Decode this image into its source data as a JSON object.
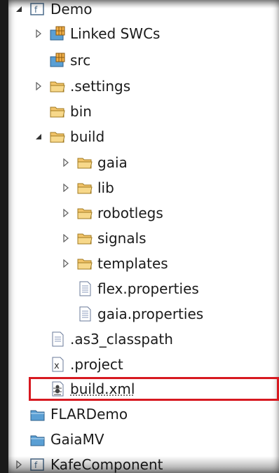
{
  "tree": {
    "items": [
      {
        "label": "Demo",
        "icon": "flex-project-icon",
        "arrow": "expanded",
        "depth": 0
      },
      {
        "label": "Linked SWCs",
        "icon": "library-icon",
        "arrow": "collapsed",
        "depth": 1
      },
      {
        "label": "src",
        "icon": "source-folder-icon",
        "arrow": "none",
        "depth": 1
      },
      {
        "label": ".settings",
        "icon": "folder-icon",
        "arrow": "collapsed",
        "depth": 1
      },
      {
        "label": "bin",
        "icon": "folder-icon",
        "arrow": "none",
        "depth": 1
      },
      {
        "label": "build",
        "icon": "folder-icon",
        "arrow": "expanded",
        "depth": 1
      },
      {
        "label": "gaia",
        "icon": "folder-icon",
        "arrow": "collapsed",
        "depth": 2
      },
      {
        "label": "lib",
        "icon": "folder-icon",
        "arrow": "collapsed",
        "depth": 2
      },
      {
        "label": "robotlegs",
        "icon": "folder-icon",
        "arrow": "collapsed",
        "depth": 2
      },
      {
        "label": "signals",
        "icon": "folder-icon",
        "arrow": "collapsed",
        "depth": 2
      },
      {
        "label": "templates",
        "icon": "folder-icon",
        "arrow": "collapsed",
        "depth": 2
      },
      {
        "label": "flex.properties",
        "icon": "properties-file-icon",
        "arrow": "none",
        "depth": 2
      },
      {
        "label": "gaia.properties",
        "icon": "properties-file-icon",
        "arrow": "none",
        "depth": 2
      },
      {
        "label": ".as3_classpath",
        "icon": "text-file-icon",
        "arrow": "none",
        "depth": 1
      },
      {
        "label": ".project",
        "icon": "xml-file-icon",
        "arrow": "none",
        "depth": 1
      },
      {
        "label": "build.xml",
        "icon": "ant-build-file-icon",
        "arrow": "none",
        "depth": 1,
        "highlighted": true
      },
      {
        "label": "FLARDemo",
        "icon": "closed-project-icon",
        "arrow": "none",
        "depth": 0
      },
      {
        "label": "GaiaMV",
        "icon": "closed-project-icon",
        "arrow": "none",
        "depth": 0
      },
      {
        "label": "KafeComponent",
        "icon": "flex-project-icon",
        "arrow": "collapsed",
        "depth": 0
      }
    ]
  },
  "colors": {
    "highlight_border": "#d71920",
    "folder_fill": "#f2c46a",
    "project_fill": "#5a9fd4"
  }
}
